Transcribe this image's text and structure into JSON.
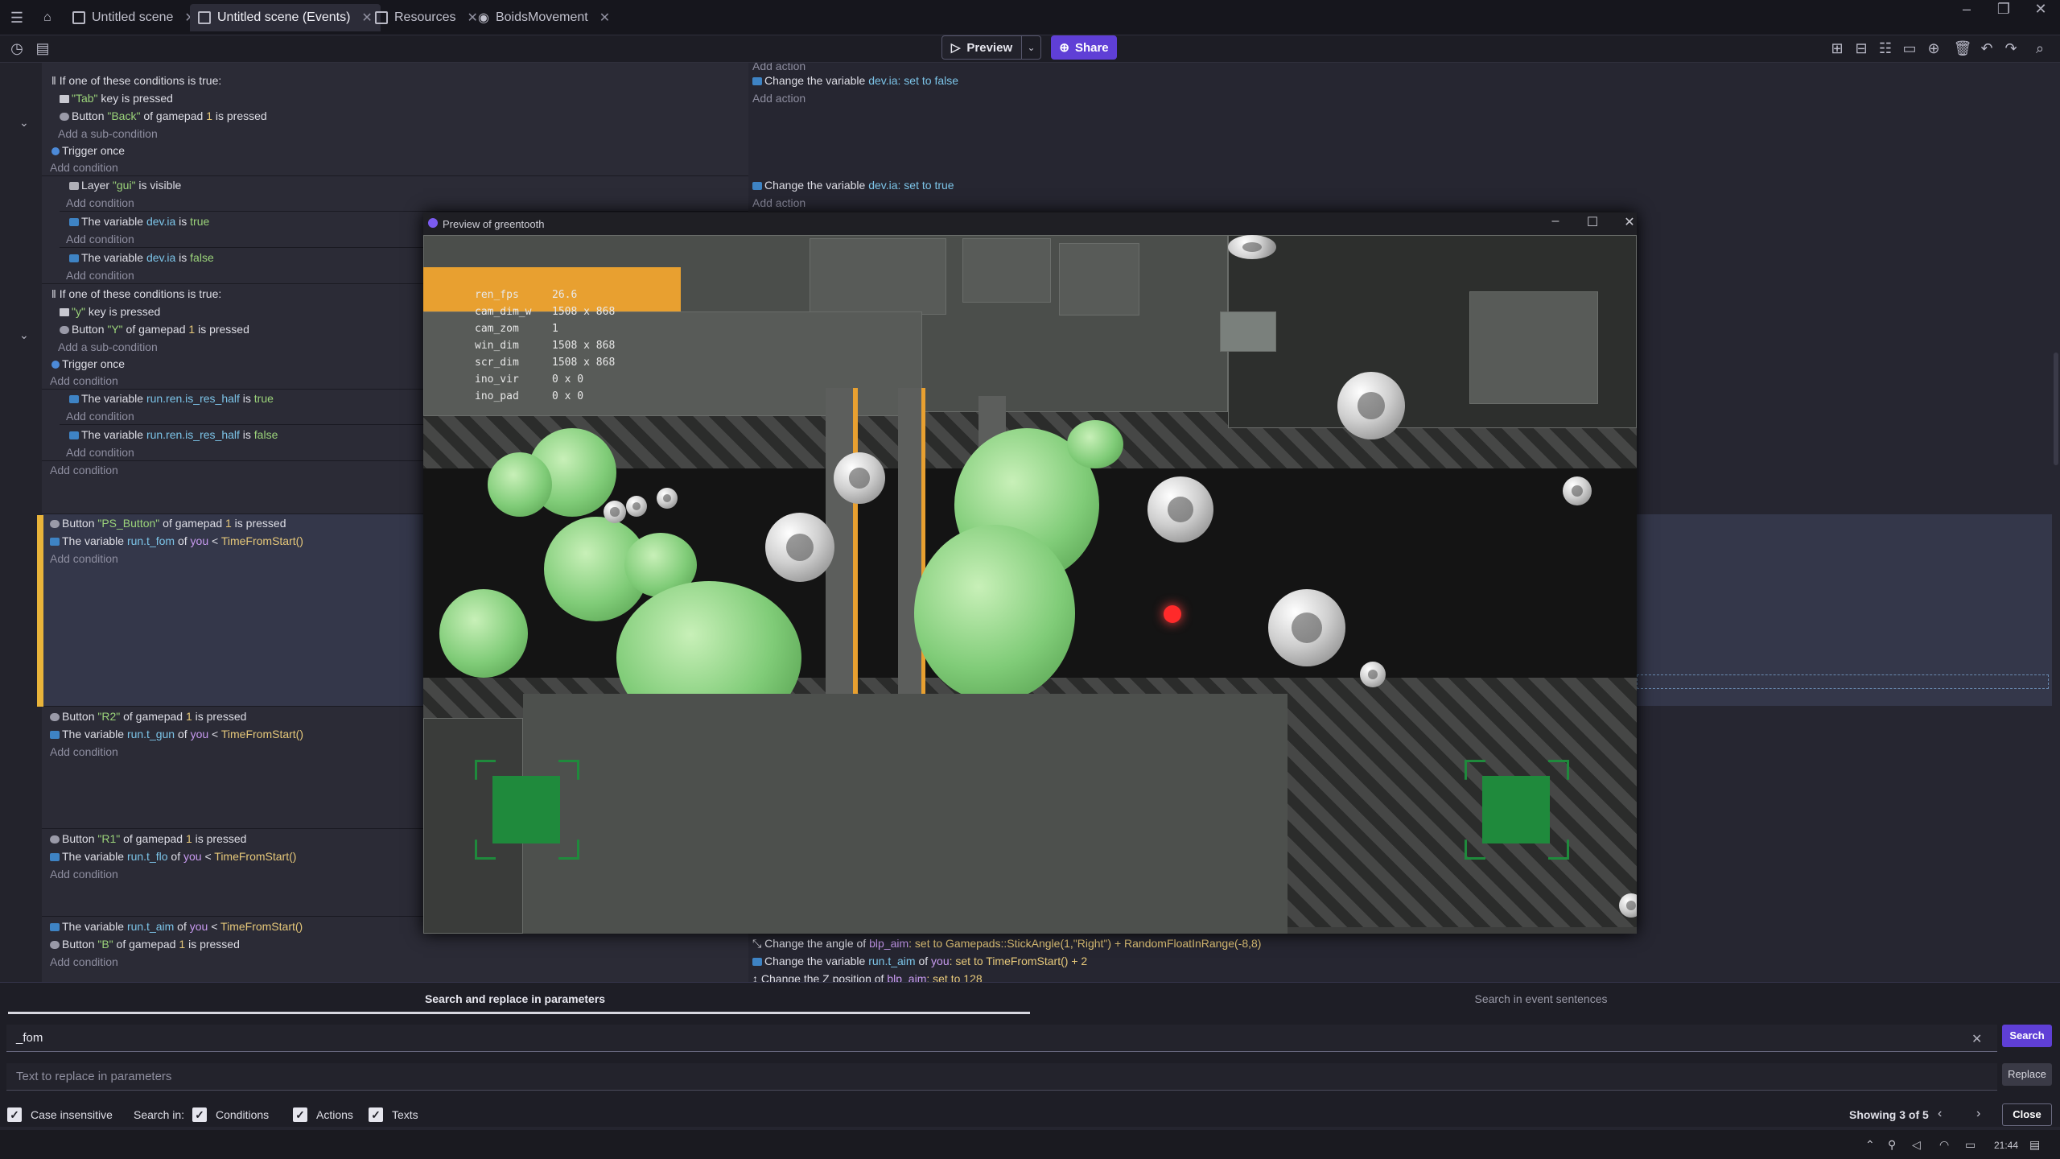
{
  "tabs": [
    {
      "label": "Untitled scene"
    },
    {
      "label": "Untitled scene (Events)"
    },
    {
      "label": "Resources"
    },
    {
      "label": "BoidsMovement"
    }
  ],
  "toolbar": {
    "preview": "Preview",
    "share": "Share"
  },
  "events": {
    "e1_header": "If one of these conditions is true:",
    "e1_c1a": "\"Tab\"",
    "e1_c1b": " key is pressed",
    "e1_c2a": "Button ",
    "e1_c2b": "\"Back\"",
    "e1_c2c": " of gamepad ",
    "e1_c2d": "1",
    "e1_c2e": " is pressed",
    "add_sub": "Add a sub-condition",
    "trigger": "Trigger once",
    "add_cond": "Add condition",
    "add_action": "Add action",
    "e1_act_a": "Change the variable ",
    "e1_act_b": "dev.ia",
    "e1_act_c": ": set to false",
    "e2_cond_a": "Layer ",
    "e2_cond_b": "\"gui\"",
    "e2_cond_c": " is visible",
    "e2_act_a": "Change the variable ",
    "e2_act_b": "dev.ia",
    "e2_act_c": ": set to true",
    "e3_a": "The variable ",
    "e3_b": "dev.ia",
    "e3_c": " is ",
    "e3_d": "true",
    "e4_d": "false",
    "e5_header": "If one of these conditions is true:",
    "e5_c1a": "\"y\"",
    "e5_c1b": " key is pressed",
    "e5_c2b": "\"Y\"",
    "e6_b": "run.ren.is_res_half",
    "ps_a": "Button ",
    "ps_b": "\"PS_Button\"",
    "ps_c": " of gamepad ",
    "ps_d": "1",
    "ps_e": " is pressed",
    "var_a": "The variable ",
    "fom": "run.t_fom",
    "of": " of ",
    "you": "you",
    "lt": " < ",
    "tfs": "TimeFromStart()",
    "r2_b": "\"R2\"",
    "gun": "run.t_gun",
    "r1_b": "\"R1\"",
    "flo": "run.t_flo",
    "aim": "run.t_aim",
    "b_b": "\"B\"",
    "act_angle_a": "Change the angle of ",
    "blp": "blp_aim",
    ":set": ": set to ",
    "act_angle_b": "Gamepads::StickAngle(1,\"Right\") + RandomFloatInRange(-8,8)",
    "act_var_a": "Change the variable ",
    "act_var_you": "you",
    ":set2": ": set to ",
    "act_var_b": "TimeFromStart() + 2",
    "act_z_a": "Change the Z position of ",
    "act_z_b": "128"
  },
  "preview": {
    "title": "Preview of greentooth",
    "debug": [
      {
        "k": "ren_fps",
        "v": "26.6"
      },
      {
        "k": "cam_dim_w",
        "v": "1508 x 868"
      },
      {
        "k": "cam_zom",
        "v": "1"
      },
      {
        "k": "win_dim",
        "v": "1508 x 868"
      },
      {
        "k": "scr_dim",
        "v": "1508 x 868"
      },
      {
        "k": "ino_vir",
        "v": "0 x 0"
      },
      {
        "k": "ino_pad",
        "v": "0 x 0"
      }
    ]
  },
  "search": {
    "tab_params": "Search and replace in parameters",
    "tab_sentences": "Search in event sentences",
    "query": "_fom",
    "replace_placeholder": "Text to replace in parameters",
    "search_btn": "Search",
    "replace_btn": "Replace",
    "case": "Case insensitive",
    "search_in": "Search in:",
    "conditions": "Conditions",
    "actions": "Actions",
    "texts": "Texts",
    "showing": "Showing 3 of 5",
    "close": "Close"
  },
  "taskbar": {
    "time": "21:44"
  }
}
